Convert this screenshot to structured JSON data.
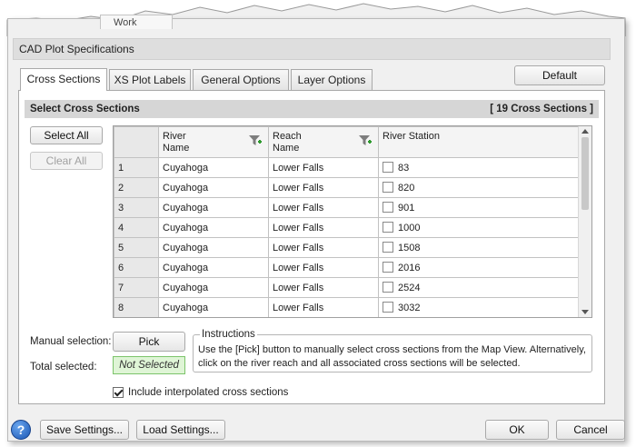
{
  "background_tab_text": "Work",
  "dialog_title": "CAD Plot Specifications",
  "default_button": "Default",
  "tabs": [
    {
      "label": "Cross Sections",
      "active": true
    },
    {
      "label": "XS Plot Labels",
      "active": false
    },
    {
      "label": "General Options",
      "active": false
    },
    {
      "label": "Layer Options",
      "active": false
    }
  ],
  "select_group": {
    "title": "Select Cross Sections",
    "count": "[ 19 Cross Sections ]",
    "select_all": "Select All",
    "clear_all": "Clear All"
  },
  "grid": {
    "columns": [
      "River Name",
      "Reach Name",
      "River Station"
    ],
    "column_lines": [
      [
        "River",
        "Name"
      ],
      [
        "Reach",
        "Name"
      ],
      [
        "River Station",
        ""
      ]
    ],
    "rows": [
      {
        "num": "1",
        "river": "Cuyahoga",
        "reach": "Lower Falls",
        "station": "83",
        "checked": false
      },
      {
        "num": "2",
        "river": "Cuyahoga",
        "reach": "Lower Falls",
        "station": "820",
        "checked": false
      },
      {
        "num": "3",
        "river": "Cuyahoga",
        "reach": "Lower Falls",
        "station": "901",
        "checked": false
      },
      {
        "num": "4",
        "river": "Cuyahoga",
        "reach": "Lower Falls",
        "station": "1000",
        "checked": false
      },
      {
        "num": "5",
        "river": "Cuyahoga",
        "reach": "Lower Falls",
        "station": "1508",
        "checked": false
      },
      {
        "num": "6",
        "river": "Cuyahoga",
        "reach": "Lower Falls",
        "station": "2016",
        "checked": false
      },
      {
        "num": "7",
        "river": "Cuyahoga",
        "reach": "Lower Falls",
        "station": "2524",
        "checked": false
      },
      {
        "num": "8",
        "river": "Cuyahoga",
        "reach": "Lower Falls",
        "station": "3032",
        "checked": false
      }
    ]
  },
  "manual_selection": {
    "label": "Manual selection:",
    "button": "Pick"
  },
  "total_selected": {
    "label": "Total selected:",
    "value": "Not Selected"
  },
  "instructions": {
    "legend": "Instructions",
    "text": "Use the [Pick] button to manually select cross sections from the Map View. Alternatively, click on the river reach and all associated cross sections will be selected."
  },
  "include_interpolated": {
    "label": "Include interpolated cross sections",
    "checked": true
  },
  "footer": {
    "help": "?",
    "save_settings": "Save Settings...",
    "load_settings": "Load Settings...",
    "ok": "OK",
    "cancel": "Cancel"
  },
  "colors": {
    "green_status_bg": "#dff5d6",
    "header_bg": "#d6d6d6",
    "help_blue": "#1a56b4"
  }
}
